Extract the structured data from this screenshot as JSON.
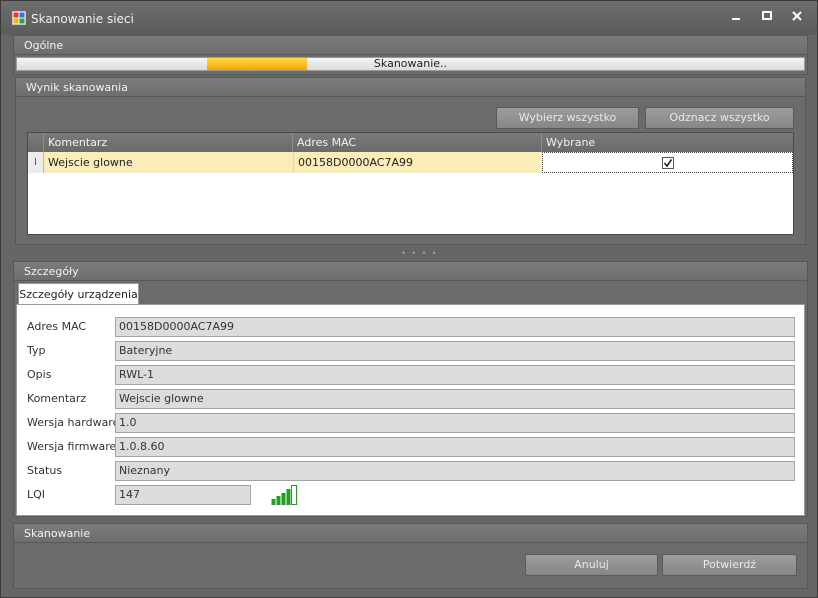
{
  "window": {
    "title": "Skanowanie sieci"
  },
  "icons": {
    "app": "network-scan-icon",
    "minimize": "minimize-icon",
    "maximize": "maximize-icon",
    "close": "close-icon",
    "signal": "signal-strength-icon",
    "row_pointer": "row-pointer-icon",
    "check": "checkmark-icon"
  },
  "general": {
    "header": "Ogólne",
    "progress_text": "Skanowanie..",
    "progress_note": "indeterminate marquee"
  },
  "results": {
    "header": "Wynik skanowania",
    "select_all": "Wybierz wszystko",
    "deselect_all": "Odznacz wszystko",
    "columns": [
      "Komentarz",
      "Adres MAC",
      "Wybrane"
    ],
    "rows": [
      {
        "comment": "Wejscie glowne",
        "mac": "00158D0000AC7A99",
        "selected": true,
        "pointer": "I"
      }
    ]
  },
  "details": {
    "header": "Szczegóły",
    "tab_label": "Szczegóły urządzenia",
    "fields": [
      {
        "label": "Adres MAC",
        "value": "00158D0000AC7A99"
      },
      {
        "label": "Typ",
        "value": "Bateryjne"
      },
      {
        "label": "Opis",
        "value": "RWL-1"
      },
      {
        "label": "Komentarz",
        "value": "Wejscie glowne"
      },
      {
        "label": "Wersja hardware",
        "value": "1.0"
      },
      {
        "label": "Wersja firmware",
        "value": "1.0.8.60"
      },
      {
        "label": "Status",
        "value": "Nieznany"
      },
      {
        "label": "LQI",
        "value": "147"
      }
    ]
  },
  "scanning": {
    "header": "Skanowanie",
    "cancel": "Anuluj",
    "confirm": "Potwierdź"
  },
  "colors": {
    "selected_row": "#fbedb8",
    "progress": "#f5b800",
    "signal": "#1fa01f"
  }
}
